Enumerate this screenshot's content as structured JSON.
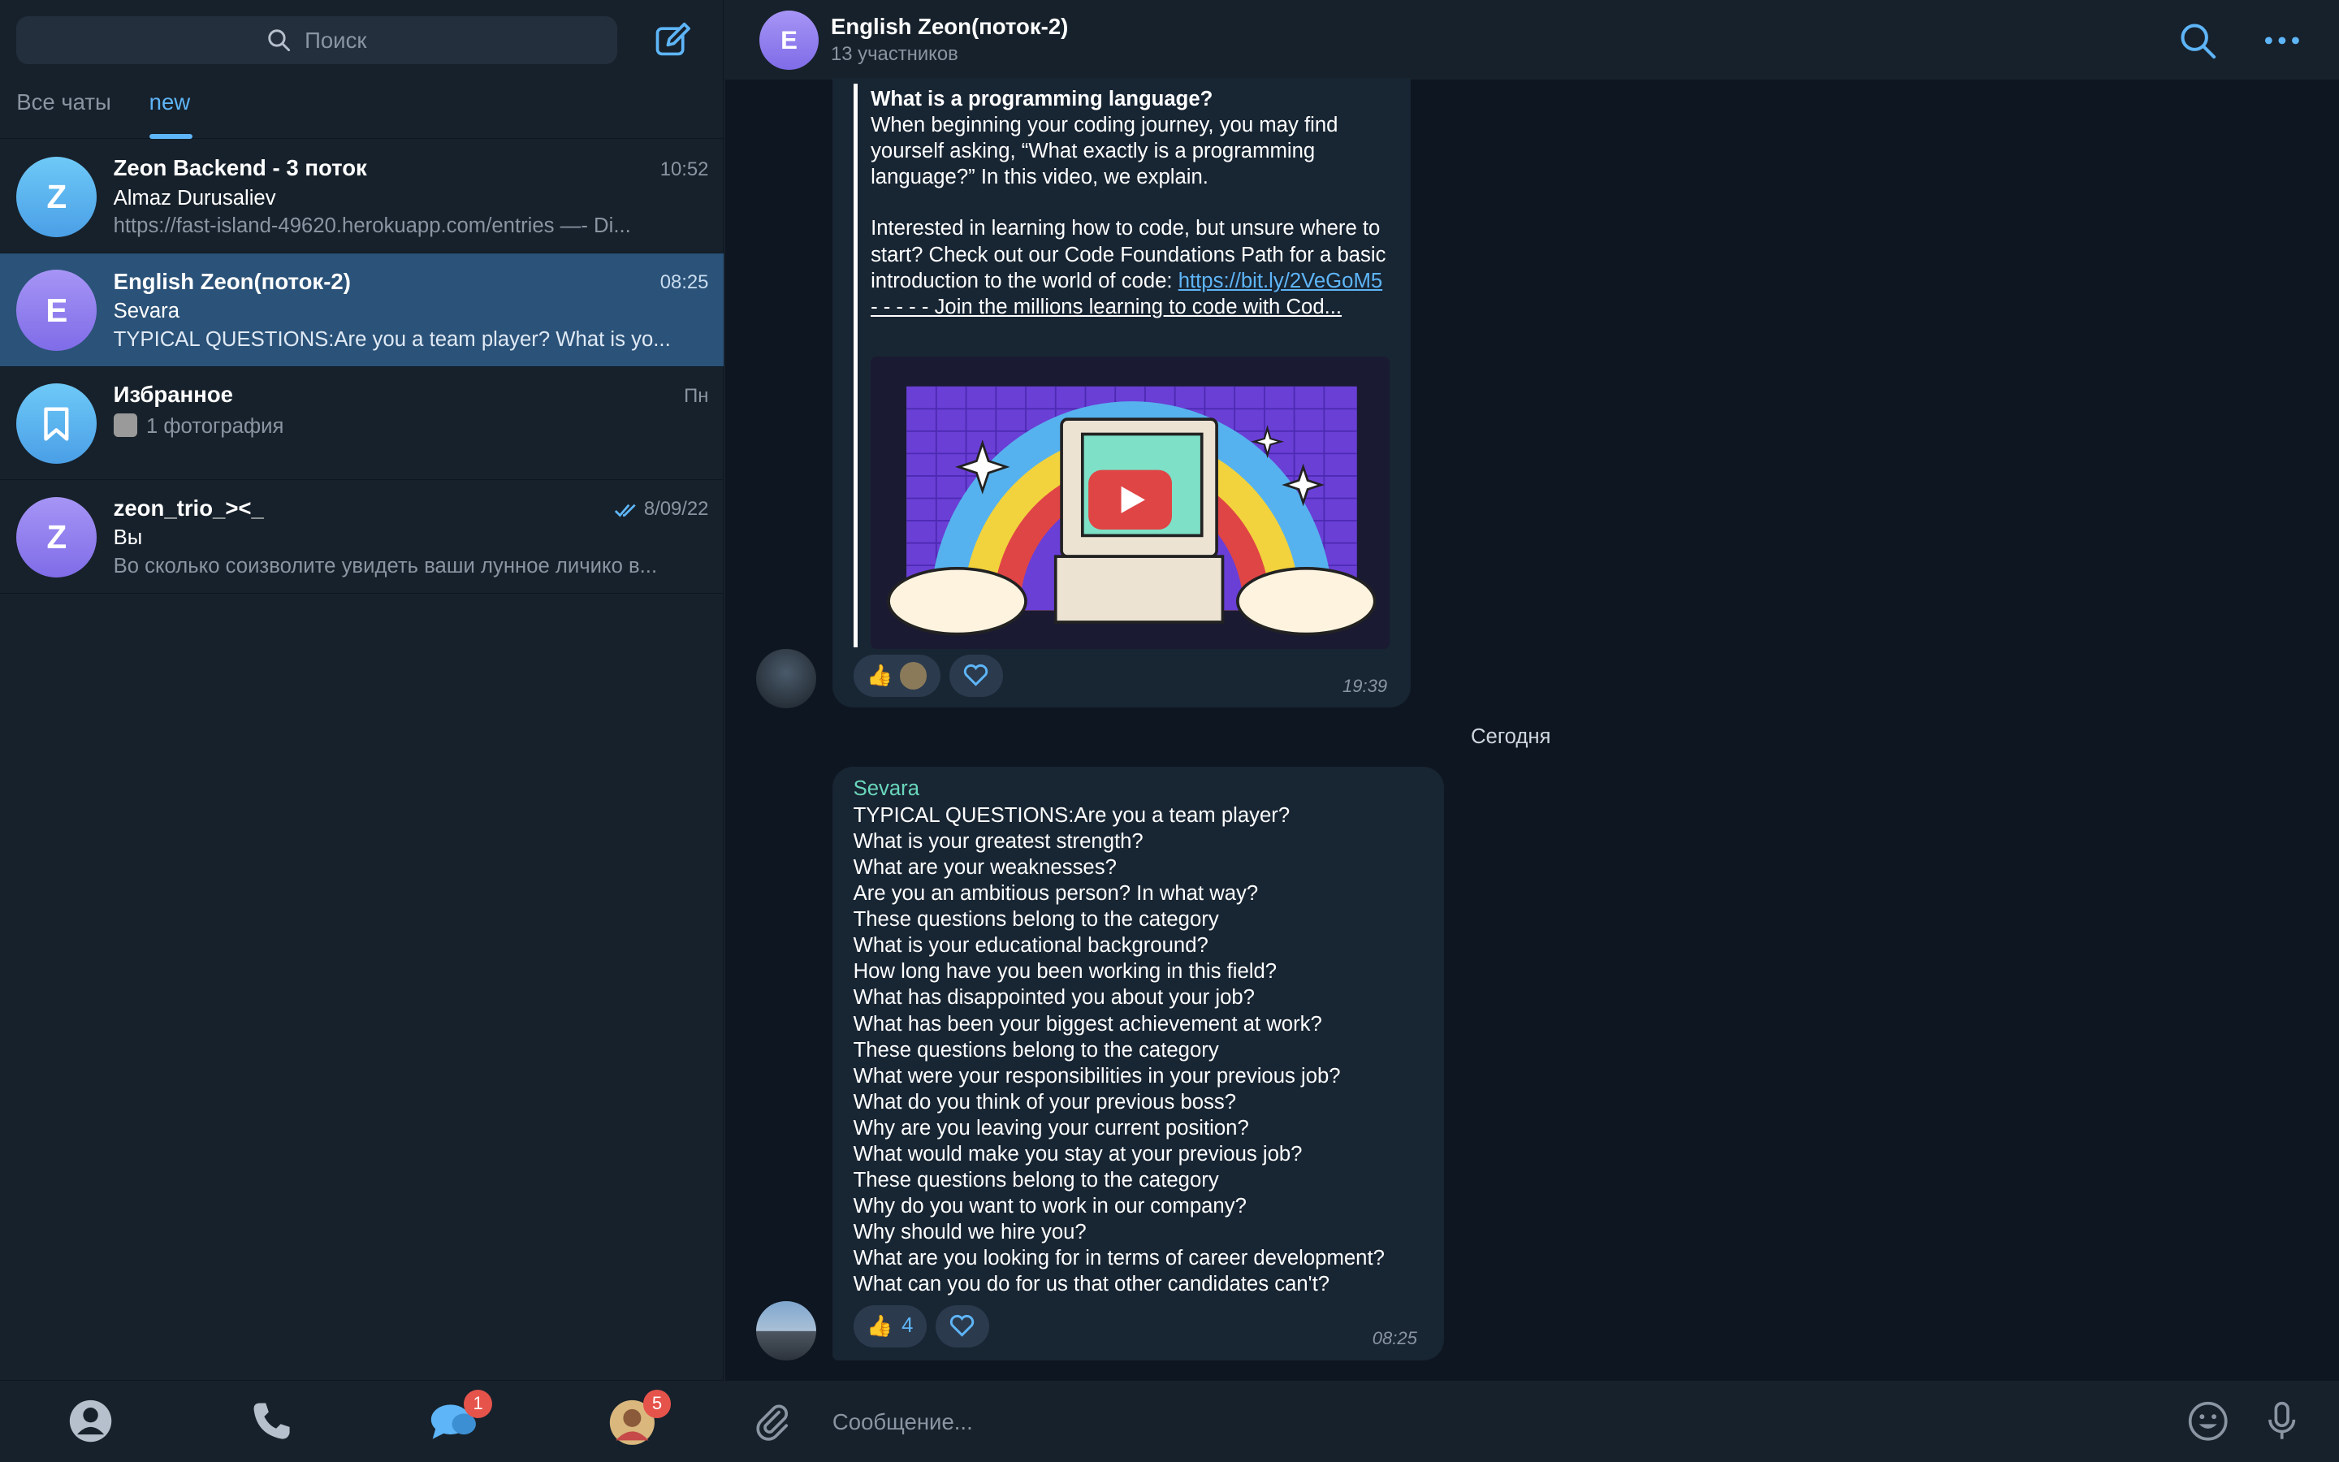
{
  "search": {
    "placeholder": "Поиск"
  },
  "tabs": [
    {
      "label": "Все чаты"
    },
    {
      "label": "new"
    }
  ],
  "chats": [
    {
      "initial": "Z",
      "title": "Zeon Backend - 3 поток",
      "time": "10:52",
      "sender": "Almaz Durusaliev",
      "preview": "https://fast-island-49620.herokuapp.com/entries  —-  Di..."
    },
    {
      "initial": "E",
      "title": "English Zeon(поток-2)",
      "time": "08:25",
      "sender": "Sevara",
      "preview": "TYPICAL QUESTIONS:Are you a team player?  What is yo..."
    },
    {
      "initial": "",
      "title": "Избранное",
      "time": "Пн",
      "sender": "",
      "preview": "1 фотография"
    },
    {
      "initial": "Z",
      "title": "zeon_trio_><_",
      "time": "8/09/22",
      "sender": "Вы",
      "preview": "Во сколько соизволите увидеть ваши лунное личико в..."
    }
  ],
  "bottom_nav": {
    "chats_badge": "1",
    "settings_badge": "5"
  },
  "header": {
    "initial": "E",
    "title": "English Zeon(поток-2)",
    "subtitle": "13 участников"
  },
  "message1": {
    "link_title": "What is a programming language?",
    "text_1": "When beginning your coding journey, you may find yourself asking, “What exactly is a programming language?” In this video, we explain.",
    "text_2": "Interested in learning how to code, but unsure where to start? Check out our Code Foundations Path for a basic introduction to the world of code: ",
    "link": "https://bit.ly/2VeGoM5",
    "text_3": "- - - - - Join the millions learning to code with Cod...",
    "reaction_1": "👍",
    "time": "19:39"
  },
  "date_separator": "Сегодня",
  "message2": {
    "sender": "Sevara",
    "lines": [
      "TYPICAL QUESTIONS:Are you a team player?",
      "What is your greatest strength?",
      "What are your weaknesses?",
      "Are you an ambitious person? In what way?",
      "These questions belong to the category",
      "What is your educational background?",
      "How long have you been working in this field?",
      "What has disappointed you about your job?",
      "What has been your biggest achievement at work?",
      "These questions belong to the category",
      "What were your responsibilities in your previous job?",
      "What do you think of your previous boss?",
      "Why are you leaving your current position?",
      "What would make you stay at your previous job?",
      "These questions belong to the category",
      "Why do you want to work in our company?",
      "Why should we hire you?",
      "What are you looking for in terms of career development?",
      "What can you do for us that other candidates can't?"
    ],
    "reaction_emoji": "👍",
    "reaction_count": "4",
    "time": "08:25"
  },
  "composer": {
    "placeholder": "Сообщение..."
  },
  "colors": {
    "accent": "#5eb5f7",
    "selected": "#2b5278",
    "bubble": "#182533",
    "badge": "#e5534b"
  }
}
